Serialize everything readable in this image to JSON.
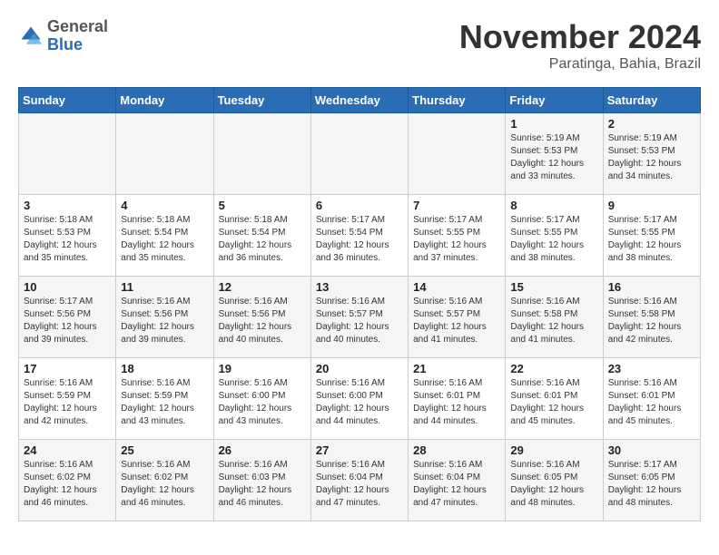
{
  "header": {
    "logo_general": "General",
    "logo_blue": "Blue",
    "month_title": "November 2024",
    "location": "Paratinga, Bahia, Brazil"
  },
  "weekdays": [
    "Sunday",
    "Monday",
    "Tuesday",
    "Wednesday",
    "Thursday",
    "Friday",
    "Saturday"
  ],
  "weeks": [
    [
      {
        "day": "",
        "info": ""
      },
      {
        "day": "",
        "info": ""
      },
      {
        "day": "",
        "info": ""
      },
      {
        "day": "",
        "info": ""
      },
      {
        "day": "",
        "info": ""
      },
      {
        "day": "1",
        "info": "Sunrise: 5:19 AM\nSunset: 5:53 PM\nDaylight: 12 hours\nand 33 minutes."
      },
      {
        "day": "2",
        "info": "Sunrise: 5:19 AM\nSunset: 5:53 PM\nDaylight: 12 hours\nand 34 minutes."
      }
    ],
    [
      {
        "day": "3",
        "info": "Sunrise: 5:18 AM\nSunset: 5:53 PM\nDaylight: 12 hours\nand 35 minutes."
      },
      {
        "day": "4",
        "info": "Sunrise: 5:18 AM\nSunset: 5:54 PM\nDaylight: 12 hours\nand 35 minutes."
      },
      {
        "day": "5",
        "info": "Sunrise: 5:18 AM\nSunset: 5:54 PM\nDaylight: 12 hours\nand 36 minutes."
      },
      {
        "day": "6",
        "info": "Sunrise: 5:17 AM\nSunset: 5:54 PM\nDaylight: 12 hours\nand 36 minutes."
      },
      {
        "day": "7",
        "info": "Sunrise: 5:17 AM\nSunset: 5:55 PM\nDaylight: 12 hours\nand 37 minutes."
      },
      {
        "day": "8",
        "info": "Sunrise: 5:17 AM\nSunset: 5:55 PM\nDaylight: 12 hours\nand 38 minutes."
      },
      {
        "day": "9",
        "info": "Sunrise: 5:17 AM\nSunset: 5:55 PM\nDaylight: 12 hours\nand 38 minutes."
      }
    ],
    [
      {
        "day": "10",
        "info": "Sunrise: 5:17 AM\nSunset: 5:56 PM\nDaylight: 12 hours\nand 39 minutes."
      },
      {
        "day": "11",
        "info": "Sunrise: 5:16 AM\nSunset: 5:56 PM\nDaylight: 12 hours\nand 39 minutes."
      },
      {
        "day": "12",
        "info": "Sunrise: 5:16 AM\nSunset: 5:56 PM\nDaylight: 12 hours\nand 40 minutes."
      },
      {
        "day": "13",
        "info": "Sunrise: 5:16 AM\nSunset: 5:57 PM\nDaylight: 12 hours\nand 40 minutes."
      },
      {
        "day": "14",
        "info": "Sunrise: 5:16 AM\nSunset: 5:57 PM\nDaylight: 12 hours\nand 41 minutes."
      },
      {
        "day": "15",
        "info": "Sunrise: 5:16 AM\nSunset: 5:58 PM\nDaylight: 12 hours\nand 41 minutes."
      },
      {
        "day": "16",
        "info": "Sunrise: 5:16 AM\nSunset: 5:58 PM\nDaylight: 12 hours\nand 42 minutes."
      }
    ],
    [
      {
        "day": "17",
        "info": "Sunrise: 5:16 AM\nSunset: 5:59 PM\nDaylight: 12 hours\nand 42 minutes."
      },
      {
        "day": "18",
        "info": "Sunrise: 5:16 AM\nSunset: 5:59 PM\nDaylight: 12 hours\nand 43 minutes."
      },
      {
        "day": "19",
        "info": "Sunrise: 5:16 AM\nSunset: 6:00 PM\nDaylight: 12 hours\nand 43 minutes."
      },
      {
        "day": "20",
        "info": "Sunrise: 5:16 AM\nSunset: 6:00 PM\nDaylight: 12 hours\nand 44 minutes."
      },
      {
        "day": "21",
        "info": "Sunrise: 5:16 AM\nSunset: 6:01 PM\nDaylight: 12 hours\nand 44 minutes."
      },
      {
        "day": "22",
        "info": "Sunrise: 5:16 AM\nSunset: 6:01 PM\nDaylight: 12 hours\nand 45 minutes."
      },
      {
        "day": "23",
        "info": "Sunrise: 5:16 AM\nSunset: 6:01 PM\nDaylight: 12 hours\nand 45 minutes."
      }
    ],
    [
      {
        "day": "24",
        "info": "Sunrise: 5:16 AM\nSunset: 6:02 PM\nDaylight: 12 hours\nand 46 minutes."
      },
      {
        "day": "25",
        "info": "Sunrise: 5:16 AM\nSunset: 6:02 PM\nDaylight: 12 hours\nand 46 minutes."
      },
      {
        "day": "26",
        "info": "Sunrise: 5:16 AM\nSunset: 6:03 PM\nDaylight: 12 hours\nand 46 minutes."
      },
      {
        "day": "27",
        "info": "Sunrise: 5:16 AM\nSunset: 6:04 PM\nDaylight: 12 hours\nand 47 minutes."
      },
      {
        "day": "28",
        "info": "Sunrise: 5:16 AM\nSunset: 6:04 PM\nDaylight: 12 hours\nand 47 minutes."
      },
      {
        "day": "29",
        "info": "Sunrise: 5:16 AM\nSunset: 6:05 PM\nDaylight: 12 hours\nand 48 minutes."
      },
      {
        "day": "30",
        "info": "Sunrise: 5:17 AM\nSunset: 6:05 PM\nDaylight: 12 hours\nand 48 minutes."
      }
    ]
  ]
}
